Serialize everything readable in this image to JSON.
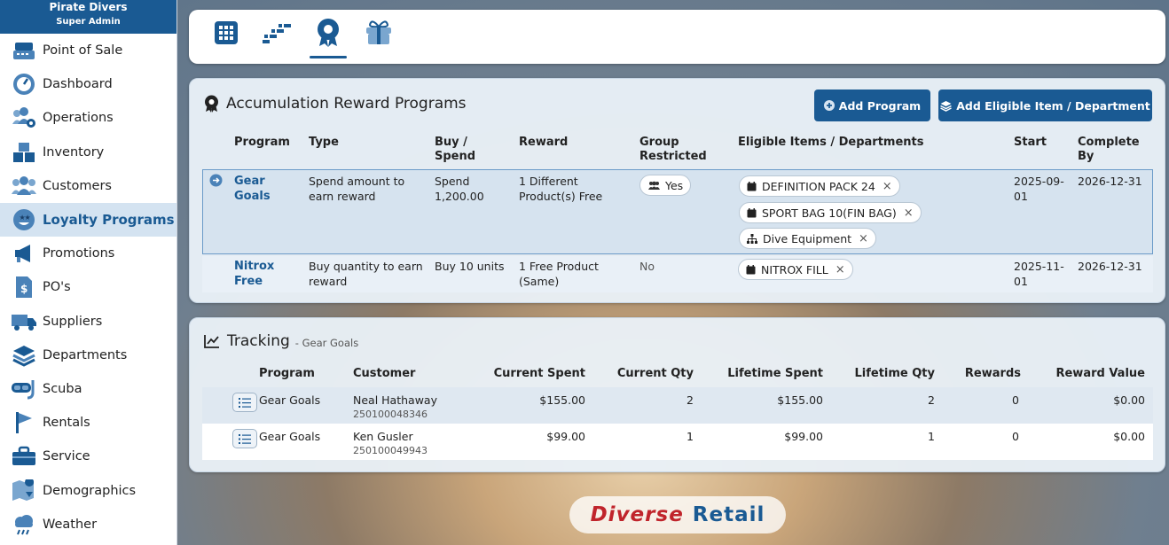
{
  "brand": {
    "name": "Pirate Divers",
    "role": "Super Admin"
  },
  "sidebar": {
    "items": [
      {
        "label": "Point of Sale",
        "icon": "register-icon"
      },
      {
        "label": "Dashboard",
        "icon": "speedometer-icon"
      },
      {
        "label": "Operations",
        "icon": "users-gear-icon"
      },
      {
        "label": "Inventory",
        "icon": "boxes-icon"
      },
      {
        "label": "Customers",
        "icon": "users-icon"
      },
      {
        "label": "Loyalty Programs",
        "icon": "star-face-icon",
        "active": true
      },
      {
        "label": "Promotions",
        "icon": "megaphone-icon"
      },
      {
        "label": "PO's",
        "icon": "invoice-icon"
      },
      {
        "label": "Suppliers",
        "icon": "truck-icon"
      },
      {
        "label": "Departments",
        "icon": "layers-icon"
      },
      {
        "label": "Scuba",
        "icon": "mask-icon"
      },
      {
        "label": "Rentals",
        "icon": "flag-icon"
      },
      {
        "label": "Service",
        "icon": "toolbox-icon"
      },
      {
        "label": "Demographics",
        "icon": "map-icon"
      },
      {
        "label": "Weather",
        "icon": "cloud-rain-icon"
      }
    ]
  },
  "tabs": [
    {
      "icon": "grid-icon"
    },
    {
      "icon": "stairs-icon"
    },
    {
      "icon": "award-icon",
      "active": true
    },
    {
      "icon": "gift-icon"
    }
  ],
  "programs": {
    "title": "Accumulation Reward Programs",
    "add_program": "Add Program",
    "add_eligible": "Add Eligible Item / Department",
    "headers": {
      "program": "Program",
      "type": "Type",
      "buy": "Buy / Spend",
      "reward": "Reward",
      "group": "Group Restricted",
      "eligible": "Eligible Items / Departments",
      "start": "Start",
      "complete": "Complete By"
    },
    "rows": [
      {
        "program": "Gear Goals",
        "type": "Spend amount to earn reward",
        "buy": "Spend 1,200.00",
        "reward": "1 Different Product(s) Free",
        "group": "Yes",
        "eligible": [
          "DEFINITION PACK 24",
          "SPORT BAG 10(FIN BAG)",
          "Dive Equipment"
        ],
        "start": "2025-09-01",
        "complete": "2026-12-31"
      },
      {
        "program": "Nitrox Free",
        "type": "Buy quantity to earn reward",
        "buy": "Buy 10 units",
        "reward": "1 Free Product (Same)",
        "group": "No",
        "eligible": [
          "NITROX FILL"
        ],
        "start": "2025-11-01",
        "complete": "2026-12-31"
      }
    ]
  },
  "tracking": {
    "title": "Tracking",
    "subtitle": "- Gear Goals",
    "headers": {
      "program": "Program",
      "customer": "Customer",
      "cur_spent": "Current Spent",
      "cur_qty": "Current Qty",
      "life_spent": "Lifetime Spent",
      "life_qty": "Lifetime Qty",
      "rewards": "Rewards",
      "reward_value": "Reward Value"
    },
    "rows": [
      {
        "program": "Gear Goals",
        "customer": "Neal Hathaway",
        "id": "250100048346",
        "cur_spent": "$155.00",
        "cur_qty": "2",
        "life_spent": "$155.00",
        "life_qty": "2",
        "rewards": "0",
        "reward_value": "$0.00"
      },
      {
        "program": "Gear Goals",
        "customer": "Ken Gusler",
        "id": "250100049943",
        "cur_spent": "$99.00",
        "cur_qty": "1",
        "life_spent": "$99.00",
        "life_qty": "1",
        "rewards": "0",
        "reward_value": "$0.00"
      }
    ]
  },
  "footer_logo": {
    "part1": "Diverse",
    "part2": "Retail"
  }
}
